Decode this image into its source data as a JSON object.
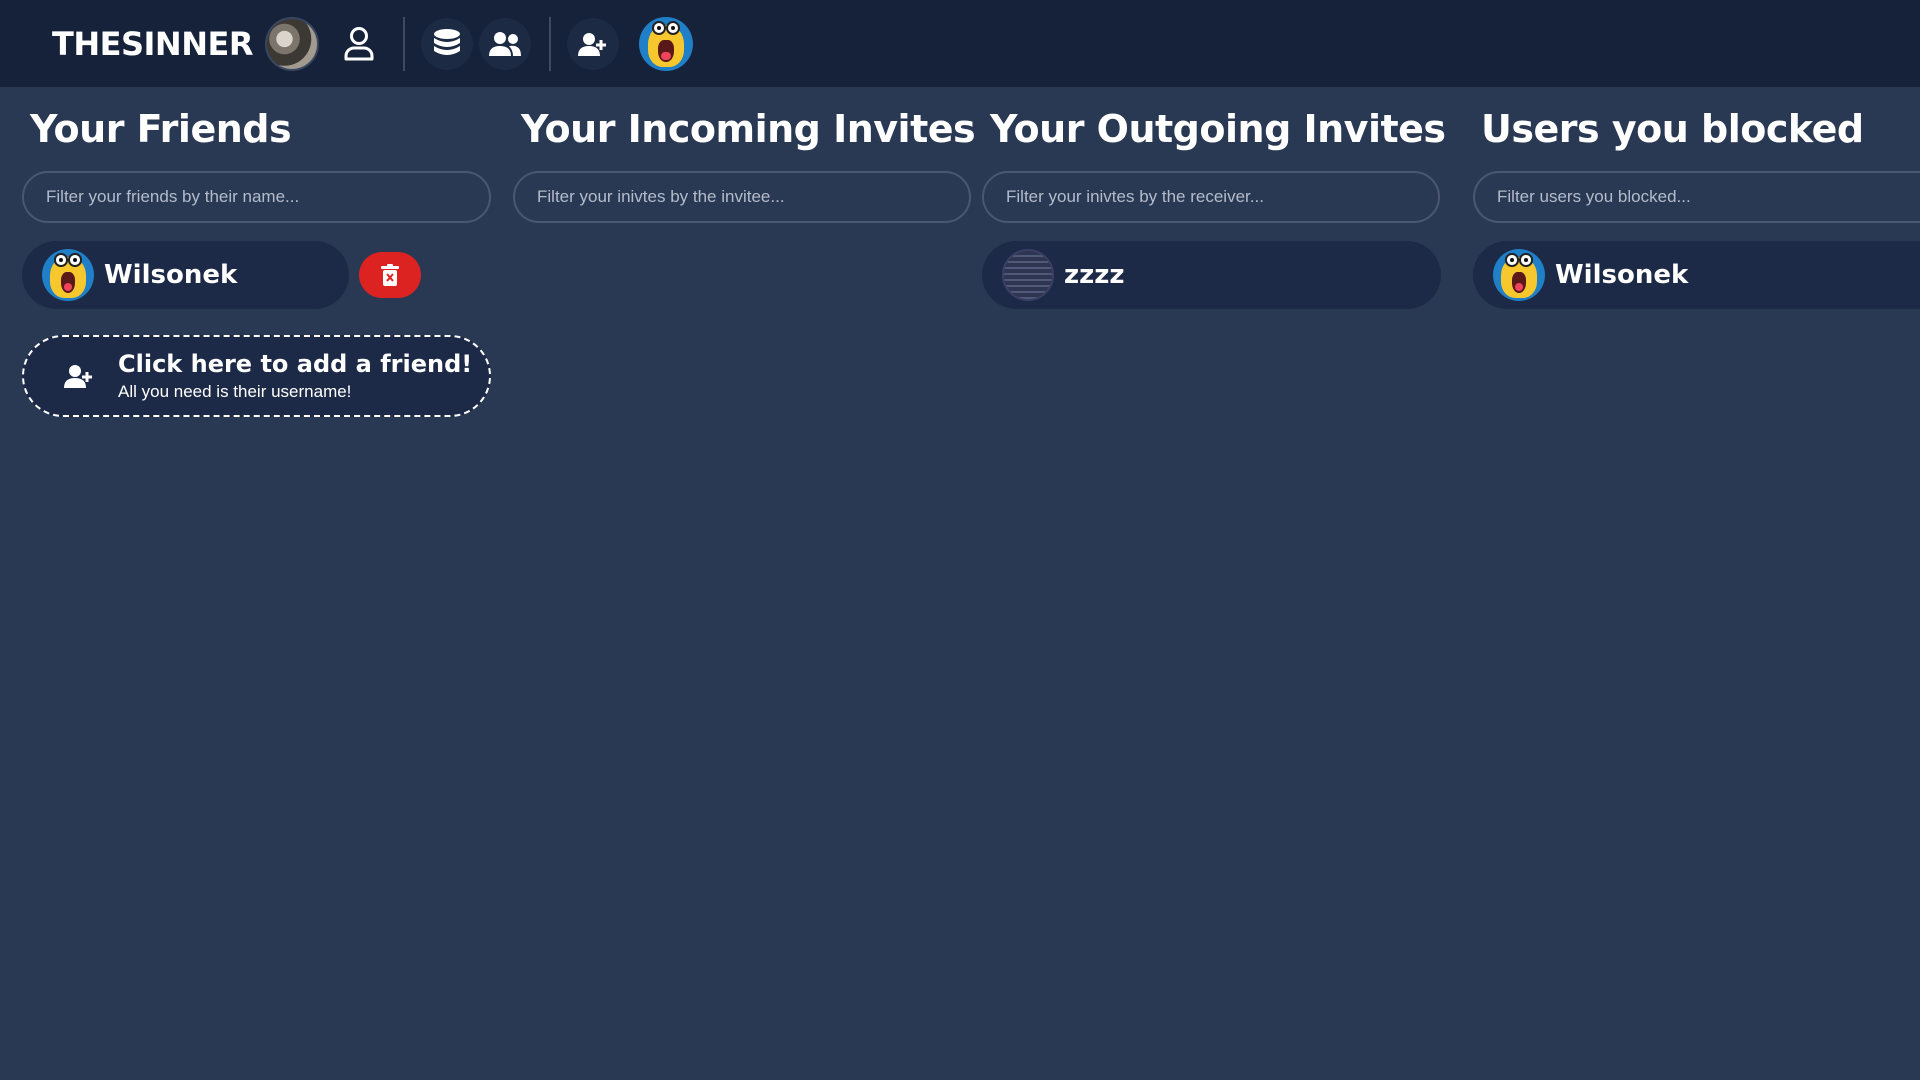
{
  "topbar": {
    "brand": "THESINNER",
    "icons": [
      "user-avatar-photo",
      "profile-icon",
      "database-icon",
      "users-icon",
      "add-user-icon",
      "mascot-avatar"
    ]
  },
  "columns": {
    "friends": {
      "title": "Your Friends",
      "filter_placeholder": "Filter your friends by their name...",
      "items": [
        {
          "name": "Wilsonek"
        }
      ]
    },
    "incoming": {
      "title": "Your Incoming Invites",
      "filter_placeholder": "Filter your inivtes by the invitee...",
      "items": []
    },
    "outgoing": {
      "title": "Your Outgoing Invites",
      "filter_placeholder": "Filter your inivtes by the receiver...",
      "items": [
        {
          "name": "zzzz"
        }
      ]
    },
    "blocked": {
      "title": "Users you blocked",
      "filter_placeholder": "Filter users you blocked...",
      "items": [
        {
          "name": "Wilsonek"
        }
      ]
    }
  },
  "add_friend": {
    "title": "Click here to add a friend!",
    "subtitle": "All you need is their username!"
  },
  "colors": {
    "page_bg": "#2a3953",
    "topbar_bg": "#16213a",
    "pill_bg": "#1d2a47",
    "danger": "#dd2222"
  }
}
